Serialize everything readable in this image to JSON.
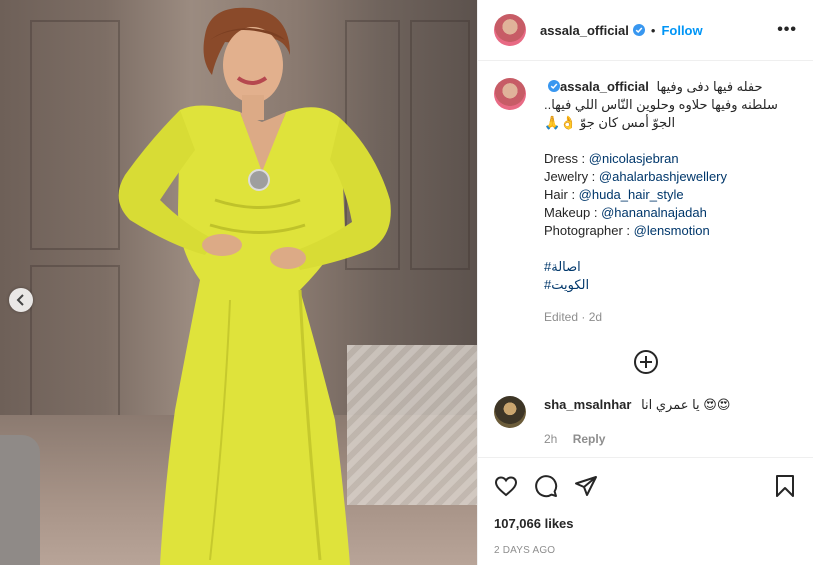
{
  "post": {
    "image_alt": "",
    "author": "assala_official",
    "follow_label": "Follow",
    "more_label": "•••",
    "dot": "•"
  },
  "caption": {
    "author": "assala_official",
    "ar_line1": "حفله فيها دفى وفيها",
    "ar_line2": "سلطنه وفيها حلاوه وحلوين النّاس اللي فيها..",
    "ar_line3": "الجوّ أمس كان جوّ 👌🙏",
    "credits": [
      {
        "label": "Dress : ",
        "handle": "@nicolasjebran"
      },
      {
        "label": "Jewelry : ",
        "handle": "@ahalarbashjewellery"
      },
      {
        "label": "Hair : ",
        "handle": "@huda_hair_style"
      },
      {
        "label": "Makeup : ",
        "handle": "@hananalnajadah"
      },
      {
        "label": "Photographer : ",
        "handle": "@lensmotion"
      }
    ],
    "hashtags": [
      "#اصالة",
      "#الكويت"
    ],
    "edited": "Edited · 2d"
  },
  "comments": [
    {
      "user": "sha_msalnhar",
      "text": "يا عمري انا 😍😍",
      "time": "2h",
      "reply": "Reply"
    }
  ],
  "actions": {
    "likes": "107,066 likes",
    "date": "2 DAYS AGO"
  },
  "colors": {
    "accent": "#0095f6",
    "mention": "#00376b",
    "muted": "#8e8e8e",
    "dress": "#d9e639"
  },
  "icons": [
    "chevron-left-icon",
    "verified-icon",
    "more-icon",
    "load-more-icon",
    "heart-icon",
    "comment-icon",
    "share-icon",
    "bookmark-icon"
  ]
}
